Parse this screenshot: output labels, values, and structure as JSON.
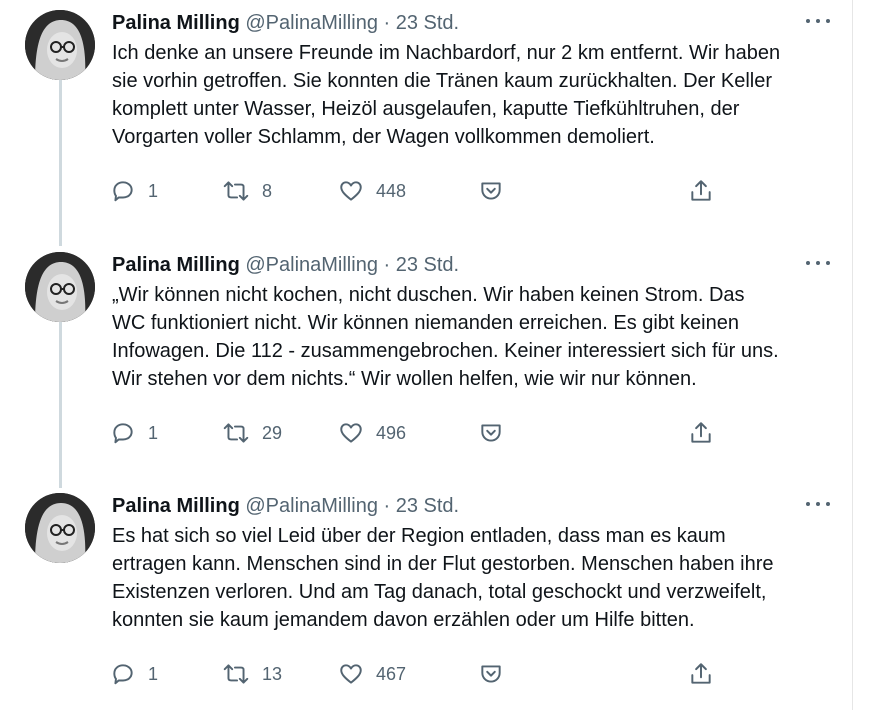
{
  "tweets": [
    {
      "author_name": "Palina Milling",
      "handle": "@PalinaMilling",
      "separator": "·",
      "time": "23 Std.",
      "lines": [
        "Ich denke an unsere Freunde im Nachbardorf, nur 2 km entfernt. Wir haben",
        "sie vorhin getroffen. Sie konnten die Tränen kaum zurückhalten. Der Keller",
        "komplett unter Wasser, Heizöl ausgelaufen, kaputte Tiefkühltruhen, der",
        "Vorgarten voller Schlamm, der Wagen vollkommen demoliert."
      ],
      "replies": "1",
      "retweets": "8",
      "likes": "448"
    },
    {
      "author_name": "Palina Milling",
      "handle": "@PalinaMilling",
      "separator": "·",
      "time": "23 Std.",
      "lines": [
        "„Wir können nicht kochen, nicht duschen. Wir haben keinen Strom. Das",
        "WC funktioniert nicht. Wir können niemanden erreichen. Es gibt keinen",
        "Infowagen. Die 112 - zusammengebrochen. Keiner interessiert sich für uns.",
        "Wir stehen vor dem nichts.“ Wir wollen helfen, wie wir nur können."
      ],
      "replies": "1",
      "retweets": "29",
      "likes": "496"
    },
    {
      "author_name": "Palina Milling",
      "handle": "@PalinaMilling",
      "separator": "·",
      "time": "23 Std.",
      "lines": [
        "Es hat sich so viel Leid über der Region entladen, dass man es kaum",
        "ertragen kann. Menschen sind in der Flut gestorben. Menschen haben ihre",
        "Existenzen verloren. Und am Tag danach, total geschockt und verzweifelt,",
        "konnten sie kaum jemandem davon erzählen oder um Hilfe bitten."
      ],
      "replies": "1",
      "retweets": "13",
      "likes": "467"
    }
  ],
  "icons": {
    "reply": "reply-icon",
    "retweet": "retweet-icon",
    "like": "heart-icon",
    "pocket": "pocket-save-icon",
    "share": "share-icon",
    "more": "more-options-icon",
    "avatar": "avatar"
  },
  "colors": {
    "text": "#0f1419",
    "secondary": "#536471",
    "thread_line": "#cfd9de",
    "background": "#ffffff"
  }
}
